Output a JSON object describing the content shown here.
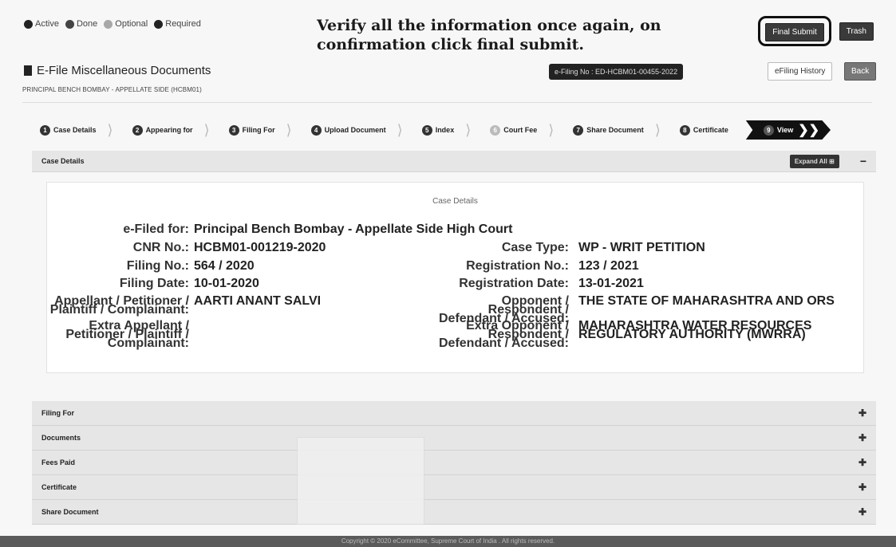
{
  "legend": [
    {
      "label": "Active",
      "color": "#222222"
    },
    {
      "label": "Done",
      "color": "#444444"
    },
    {
      "label": "Optional",
      "color": "#a8a8a8"
    },
    {
      "label": "Required",
      "color": "#222222"
    }
  ],
  "instruction": "Verify all the information once again, on confirmation click final submit.",
  "buttons": {
    "final_submit": "Final Submit",
    "trash": "Trash",
    "efiling_history": "eFiling History",
    "back": "Back"
  },
  "efiling_no": "e-Filing No : ED-HCBM01-00455-2022",
  "title": "E-File Miscellaneous Documents",
  "subtitle": "PRINCIPAL BENCH BOMBAY - APPELLATE SIDE (HCBM01)",
  "steps": [
    {
      "num": "1",
      "label": "Case Details"
    },
    {
      "num": "2",
      "label": "Appearing for"
    },
    {
      "num": "3",
      "label": "Filing For"
    },
    {
      "num": "4",
      "label": "Upload Document"
    },
    {
      "num": "5",
      "label": "Index"
    },
    {
      "num": "6",
      "label": "Court Fee"
    },
    {
      "num": "7",
      "label": "Share Document"
    },
    {
      "num": "8",
      "label": "Certificate"
    },
    {
      "num": "9",
      "label": "View"
    }
  ],
  "case_section": {
    "header": "Case Details",
    "expand_all": "Expand All",
    "panel_title": "Case Details",
    "efiled_for_label": "e-Filed for:",
    "efiled_for_value": "Principal Bench Bombay - Appellate Side High Court",
    "cnr_label": "CNR No.:",
    "cnr_value": "HCBM01-001219-2020",
    "filing_no_label": "Filing No.:",
    "filing_no_value": "564 / 2020",
    "filing_date_label": "Filing Date:",
    "filing_date_value": "10-01-2020",
    "appellant_label": "Appellant / Petitioner / Plaintiff / Complainant:",
    "appellant_value": "AARTI ANANT SALVI",
    "extra_appellant_label": "Extra Appellant / Petitioner / Plaintiff / Complainant:",
    "case_type_label": "Case Type:",
    "case_type_value": "WP - WRIT PETITION",
    "reg_no_label": "Registration No.:",
    "reg_no_value": "123 / 2021",
    "reg_date_label": "Registration Date:",
    "reg_date_value": "13-01-2021",
    "opponent_label": "Opponent / Respondent / Defendant / Accused:",
    "opponent_value": "THE STATE OF MAHARASHTRA AND ORS",
    "extra_opponent_label": "Extra Opponent / Respondent / Defendant / Accused:",
    "extra_opponent_value": "MAHARASHTRA WATER RESOURCES REGULATORY AUTHORITY (MWRRA)"
  },
  "sections": [
    "Filing For",
    "Documents",
    "Fees Paid",
    "Certificate",
    "Share Document"
  ],
  "footer": "Copyright © 2020 eCommittee, Supreme Court of India . All rights reserved."
}
